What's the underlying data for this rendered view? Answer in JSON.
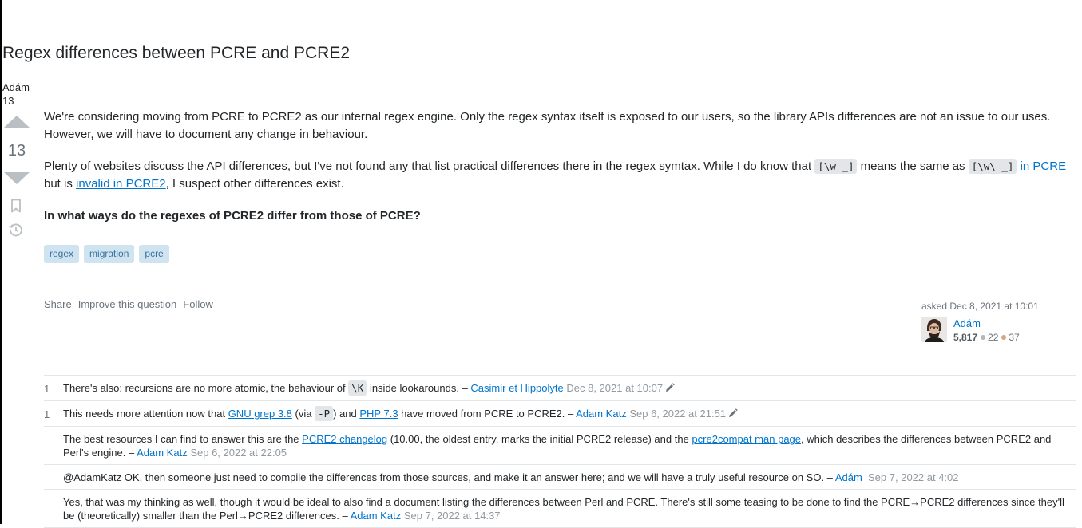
{
  "question": {
    "title": "Regex differences between PCRE and PCRE2",
    "asker_mini_name": "Adám",
    "asker_mini_num": "13",
    "votes": "13",
    "body": {
      "p1": "We're considering moving from PCRE to PCRE2 as our internal regex engine. Only the regex syntax itself is exposed to our users, so the library APIs differences are not an issue to our uses. However, we will have to document any change in behaviour.",
      "p2_a": "Plenty of websites discuss the API differences, but I've not found any that list practical differences there in the regex symtax. While I do know that ",
      "p2_code1": "[\\w-_]",
      "p2_b": " means the same as ",
      "p2_code2": "[\\w\\-_]",
      "p2_c": " ",
      "p2_link1": "in PCRE",
      "p2_d": " but is ",
      "p2_link2": "invalid in PCRE2",
      "p2_e": ", I suspect other differences exist.",
      "p3": "In what ways do the regexes of PCRE2 differ from those of PCRE?"
    },
    "tags": [
      "regex",
      "migration",
      "pcre"
    ],
    "actions": {
      "share": "Share",
      "improve": "Improve this question",
      "follow": "Follow"
    },
    "asked": "asked Dec 8, 2021 at 10:01",
    "user": {
      "name": "Adám",
      "rep": "5,817",
      "silver": "22",
      "bronze": "37"
    }
  },
  "comments": [
    {
      "score": "1",
      "t1": "There's also: recursions are no more atomic, the behaviour of ",
      "code": "\\K",
      "t2": " inside lookarounds. – ",
      "user": "Casimir et Hippolyte",
      "date": "Dec 8, 2021 at 10:07"
    },
    {
      "score": "1",
      "t1": "This needs more attention now that ",
      "link1": "GNU grep 3.8",
      "t2": " (via ",
      "code": "-P",
      "t3": ") and ",
      "link2": "PHP 7.3",
      "t4": " have moved from PCRE to PCRE2. – ",
      "user": "Adam Katz",
      "date": "Sep 6, 2022 at 21:51"
    },
    {
      "t1": "The best resources I can find to answer this are the ",
      "link1": "PCRE2 changelog",
      "t2": " (10.00, the oldest entry, marks the initial PCRE2 release) and the ",
      "link2": "pcre2compat man page",
      "t3": ", which describes the differences between PCRE2 and Perl's engine. – ",
      "user": "Adam Katz",
      "date": "Sep 6, 2022 at 22:05"
    },
    {
      "t1": "@AdamKatz OK, then someone just need to compile the differences from those sources, and make it an answer here; and we will have a truly useful resource on SO. – ",
      "user": "Adám",
      "date": "Sep 7, 2022 at 4:02"
    },
    {
      "t1": "Yes, that was my thinking as well, though it would be ideal to also find a document listing the differences between Perl and PCRE. There's still some teasing to be done to find the PCRE→PCRE2 differences since they'll be (theoretically) smaller than the Perl→PCRE2 differences. – ",
      "user": "Adam Katz",
      "date": "Sep 7, 2022 at 14:37"
    }
  ],
  "colors": {
    "link": "#0074cc",
    "tag_bg": "#d0e3f1",
    "tag_fg": "#39739d",
    "silver": "#b4b8bc",
    "bronze": "#d1a684"
  },
  "icons": [
    "upvote-icon",
    "downvote-icon",
    "bookmark-icon",
    "history-icon",
    "edit-pencil-icon"
  ]
}
